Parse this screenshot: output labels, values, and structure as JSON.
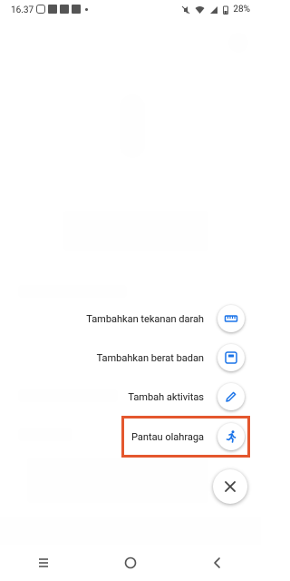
{
  "status_bar": {
    "time": "16.37",
    "battery": "28%",
    "icons": [
      "instagram-icon",
      "facebook-icon",
      "facebook-icon",
      "facebook-icon",
      "dot-icon",
      "mute-icon",
      "wifi-icon",
      "signal-icon",
      "battery-icon"
    ]
  },
  "menu": {
    "items": [
      {
        "label": "Tambahkan tekanan darah",
        "icon": "ruler-icon"
      },
      {
        "label": "Tambahkan berat badan",
        "icon": "scale-icon"
      },
      {
        "label": "Tambah aktivitas",
        "icon": "pencil-icon"
      },
      {
        "label": "Pantau olahraga",
        "icon": "running-icon"
      }
    ],
    "close_icon": "close-icon"
  },
  "colors": {
    "accent": "#1a73e8",
    "highlight": "#e4572e"
  },
  "nav_bar": {
    "icons": [
      "recent-apps-icon",
      "home-icon",
      "back-icon"
    ]
  }
}
